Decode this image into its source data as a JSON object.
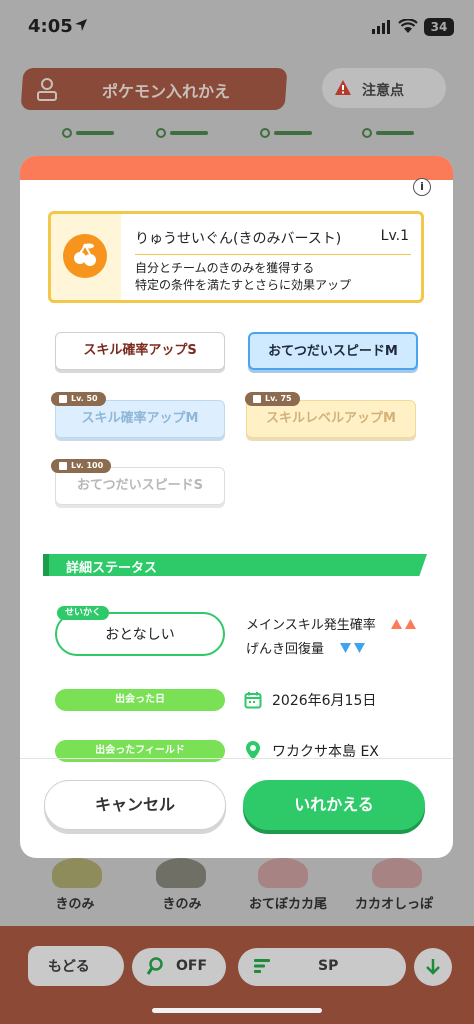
{
  "status_bar": {
    "time": "4:05",
    "battery": "34"
  },
  "background": {
    "swap_title": "ポケモン入れかえ",
    "notice_label": "注意点",
    "pokemon_labels": [
      "きのみ",
      "きのみ",
      "おてぼカカ尾",
      "カカオしっぽ"
    ],
    "bottom_bar": {
      "back_label": "もどる",
      "off_label": "OFF",
      "sp_label": "SP"
    }
  },
  "modal": {
    "skill_card": {
      "name": "りゅうせいぐん(きのみバースト)",
      "level": "Lv.1",
      "description_line1": "自分とチームのきのみを獲得する",
      "description_line2": "特定の条件を満たすとさらに効果アップ",
      "info_glyph": "i",
      "icon": "berry-icon"
    },
    "sub_skills": [
      {
        "label": "スキル確率アップS",
        "locked": false,
        "badge": ""
      },
      {
        "label": "おてつだいスピードM",
        "locked": false,
        "badge": ""
      },
      {
        "label": "スキル確率アップM",
        "locked": true,
        "badge": "Lv. 50"
      },
      {
        "label": "スキルレベルアップM",
        "locked": true,
        "badge": "Lv. 75"
      },
      {
        "label": "おてつだいスピードS",
        "locked": true,
        "badge": "Lv. 100"
      }
    ],
    "details": {
      "header": "詳細ステータス",
      "nature_tag": "せいかく",
      "nature_value": "おとなしい",
      "stat_up": "メインスキル発生確率",
      "stat_down": "げんき回復量",
      "met_date_label": "出会った日",
      "met_date_value": "2026年6月15日",
      "met_field_label": "出会ったフィールド",
      "met_field_value": "ワカクサ本島 EX"
    },
    "buttons": {
      "cancel": "キャンセル",
      "confirm": "いれかえる"
    }
  },
  "colors": {
    "accent_green": "#2ec968",
    "header_orange": "#fb7a57",
    "skill_gold": "#f2c84b"
  }
}
